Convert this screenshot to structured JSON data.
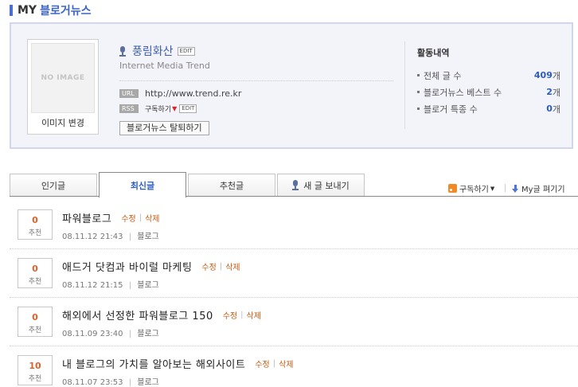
{
  "header": {
    "my": "MY",
    "title": "블로거뉴스"
  },
  "profile": {
    "no_image": "NO IMAGE",
    "change_image": "이미지 변경",
    "blog_name": "풍림화산",
    "edit": "EDIT",
    "subtitle": "Internet Media Trend",
    "url_tag": "URL",
    "url": "http://www.trend.re.kr",
    "rss_tag": "RSS",
    "subscribe": "구독하기",
    "rss_edit": "EDIT",
    "withdraw": "블로거뉴스 탈퇴하기"
  },
  "activity": {
    "title": "활동내역",
    "items": [
      {
        "label": "전체 글 수",
        "value": "409",
        "unit": "개"
      },
      {
        "label": "블로거뉴스 베스트 수",
        "value": "2",
        "unit": "개"
      },
      {
        "label": "블로거 특종 수",
        "value": "0",
        "unit": "개"
      }
    ]
  },
  "tabs": [
    {
      "label": "인기글"
    },
    {
      "label": "최신글"
    },
    {
      "label": "추천글"
    },
    {
      "label": "새 글 보내기"
    }
  ],
  "toolbar": {
    "subscribe": "구독하기",
    "my_posts": "My글 펴기기"
  },
  "posts": [
    {
      "votes": "0",
      "vote_label": "추천",
      "title": "파워블로그",
      "edit": "수정",
      "delete": "삭제",
      "date": "08.11.12 21:43",
      "category": "블로그"
    },
    {
      "votes": "0",
      "vote_label": "추천",
      "title": "애드거 닷컴과 바이럴 마케팅",
      "edit": "수정",
      "delete": "삭제",
      "date": "08.11.12 21:15",
      "category": "블로그"
    },
    {
      "votes": "0",
      "vote_label": "추천",
      "title": "해외에서 선정한 파워블로그 150",
      "edit": "수정",
      "delete": "삭제",
      "date": "08.11.09 23:40",
      "category": "블로그"
    },
    {
      "votes": "10",
      "vote_label": "추천",
      "title": "내 블로그의 가치를 알아보는 해외사이트",
      "edit": "수정",
      "delete": "삭제",
      "date": "08.11.07 23:53",
      "category": "블로그"
    }
  ],
  "colors": {
    "accent": "#3d66c8",
    "vote": "#e0602a",
    "action": "#c25a10"
  }
}
